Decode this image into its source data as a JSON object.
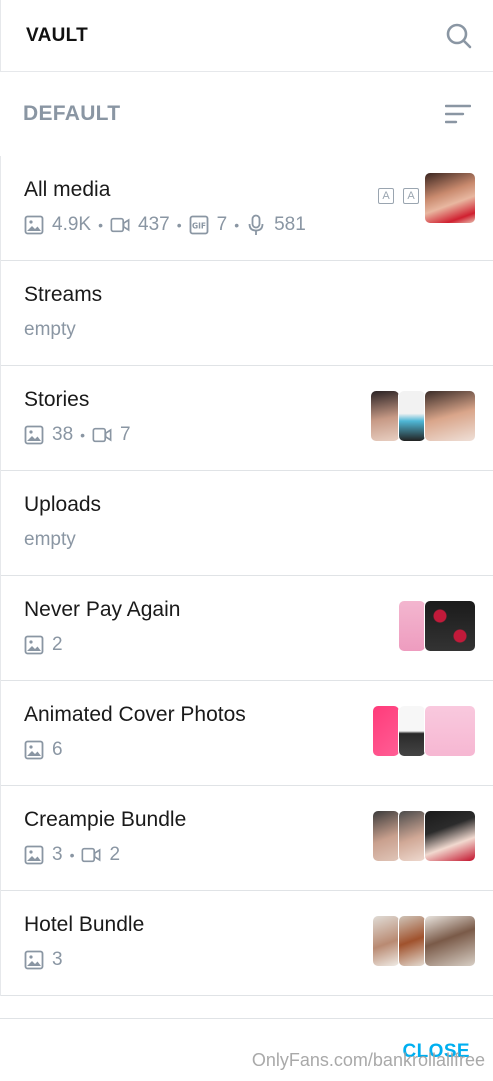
{
  "header": {
    "title": "VAULT",
    "search_icon": "search-icon"
  },
  "section": {
    "label": "DEFAULT",
    "sort_icon": "sort-icon"
  },
  "lists": [
    {
      "name": "All media",
      "photos": "4.9K",
      "videos": "437",
      "gifs": "7",
      "audio": "581"
    },
    {
      "name": "Streams",
      "empty": "empty"
    },
    {
      "name": "Stories",
      "photos": "38",
      "videos": "7"
    },
    {
      "name": "Uploads",
      "empty": "empty"
    },
    {
      "name": "Never Pay Again",
      "photos": "2"
    },
    {
      "name": "Animated Cover Photos",
      "photos": "6"
    },
    {
      "name": "Creampie Bundle",
      "photos": "3",
      "videos": "2"
    },
    {
      "name": "Hotel Bundle",
      "photos": "3"
    }
  ],
  "footer": {
    "close_label": "CLOSE"
  },
  "watermark": "OnlyFans.com/bankrollallfree",
  "colors": {
    "accent": "#00aff0",
    "muted": "#8a96a3",
    "divider": "#e0e3e6"
  }
}
